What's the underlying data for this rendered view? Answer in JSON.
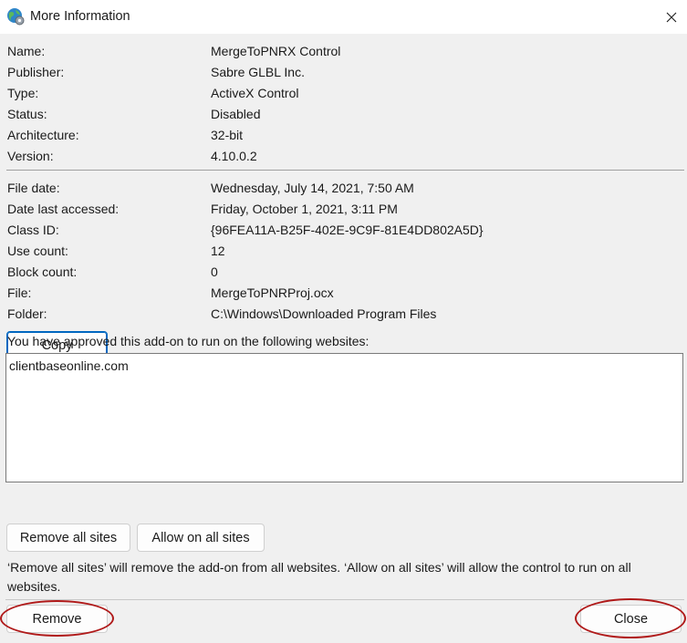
{
  "window": {
    "title": "More Information",
    "app_icon": "globe-gear-icon",
    "close_icon": "close-icon"
  },
  "details_top": [
    {
      "key": "Name:",
      "value": "MergeToPNRX Control"
    },
    {
      "key": "Publisher:",
      "value": "Sabre GLBL Inc."
    },
    {
      "key": "Type:",
      "value": "ActiveX Control"
    },
    {
      "key": "Status:",
      "value": "Disabled"
    },
    {
      "key": "Architecture:",
      "value": "32-bit"
    },
    {
      "key": "Version:",
      "value": "4.10.0.2"
    }
  ],
  "details_bottom": [
    {
      "key": "File date:",
      "value": "Wednesday, July 14, 2021, 7:50 AM"
    },
    {
      "key": "Date last accessed:",
      "value": "Friday, October 1, 2021, 3:11 PM"
    },
    {
      "key": "Class ID:",
      "value": "{96FEA11A-B25F-402E-9C9F-81E4DD802A5D}"
    },
    {
      "key": "Use count:",
      "value": "12"
    },
    {
      "key": "Block count:",
      "value": "0"
    },
    {
      "key": "File:",
      "value": "MergeToPNRProj.ocx"
    },
    {
      "key": "Folder:",
      "value": "C:\\Windows\\Downloaded Program Files"
    }
  ],
  "copy_button": "Copy",
  "approved_label": "You have approved this add-on to run on the following websites:",
  "sites": [
    "clientbaseonline.com"
  ],
  "remove_all_sites_button": "Remove all sites",
  "allow_all_sites_button": "Allow on all sites",
  "note": "‘Remove all sites’ will remove the add-on from all websites. ‘Allow on all sites’ will allow the control to run on all websites.",
  "remove_button": "Remove",
  "close_button": "Close",
  "annotation_color": "#b01a1a"
}
